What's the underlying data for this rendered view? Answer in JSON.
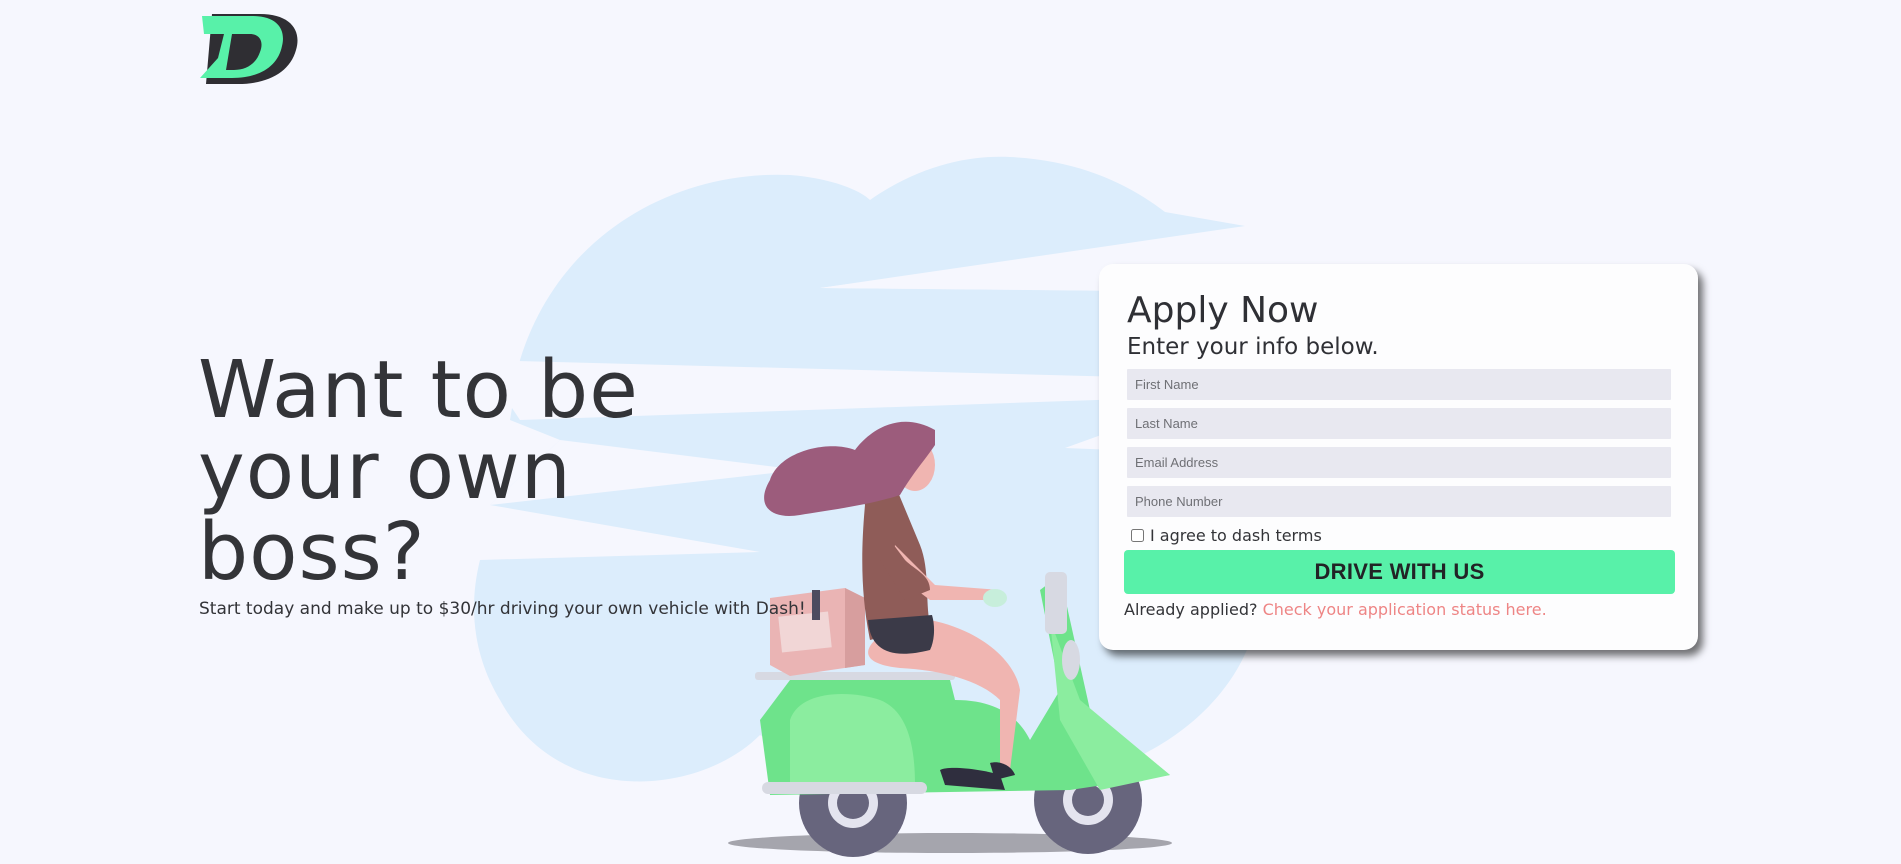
{
  "brand": {
    "logo_icon": "dash-logo-icon",
    "accent": "#58f1a9",
    "dark": "#333438",
    "link_color": "#ee8585"
  },
  "hero": {
    "heading": "Want to be your own boss?",
    "subtext": "Start today and make up to $30/hr driving your own vehicle with Dash!"
  },
  "form": {
    "title": "Apply Now",
    "subtitle": "Enter your info below.",
    "fields": {
      "first_name": {
        "placeholder": "First Name",
        "value": ""
      },
      "last_name": {
        "placeholder": "Last Name",
        "value": ""
      },
      "email": {
        "placeholder": "Email Address",
        "value": ""
      },
      "phone": {
        "placeholder": "Phone Number",
        "value": ""
      }
    },
    "terms_label": "I agree to dash terms",
    "terms_checked": false,
    "submit_label": "DRIVE WITH US",
    "already_text": "Already applied?",
    "status_link": "Check your application status here."
  },
  "illustration": {
    "name": "woman-riding-scooter-illustration",
    "cloud_color": "#dcedfc",
    "scooter_color": "#6ee38b"
  }
}
